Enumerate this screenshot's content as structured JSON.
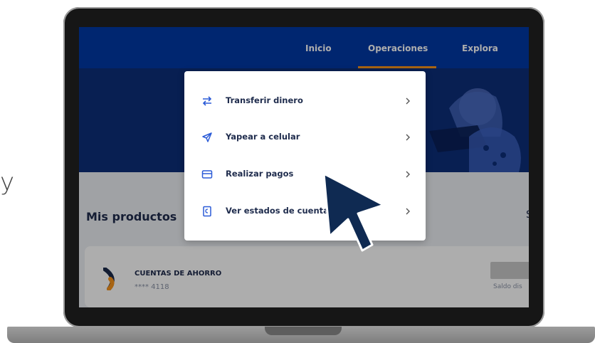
{
  "side_text": "y",
  "nav": {
    "items": [
      "Inicio",
      "Operaciones",
      "Explora"
    ],
    "active": "Operaciones",
    "colors": {
      "bar": "#0039a6",
      "active_underline": "#f7941d"
    }
  },
  "dropdown": {
    "items": [
      {
        "label": "Transferir dinero",
        "icon": "transfer-arrows-icon"
      },
      {
        "label": "Yapear a celular",
        "icon": "send-paper-plane-icon"
      },
      {
        "label": "Realizar pagos",
        "icon": "card-icon"
      },
      {
        "label": "Ver estados de cuenta",
        "icon": "document-icon"
      }
    ],
    "chevron_icon": "chevron-right-icon",
    "accent_color": "#2b5bd7"
  },
  "main": {
    "section_title": "Mis productos",
    "right_partial": "S",
    "account": {
      "name": "CUENTAS DE AHORRO",
      "number": "**** 4118",
      "balance_label": "Saldo dis",
      "icon": "chevron-logo-icon",
      "logo_colors": [
        "#1b2a4a",
        "#f7941d"
      ]
    }
  },
  "cursor": {
    "icon": "mouse-pointer-icon",
    "color": "#0f2a52"
  }
}
